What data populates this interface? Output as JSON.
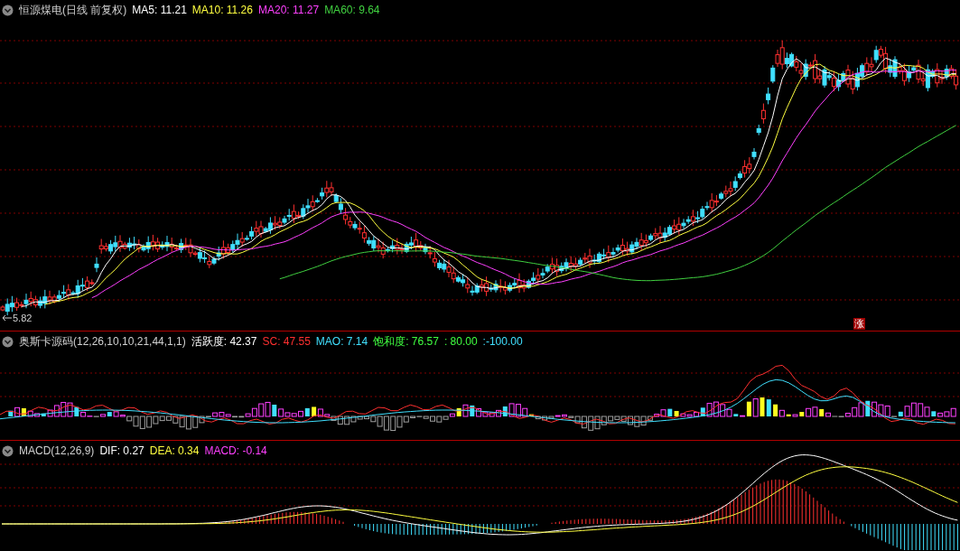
{
  "main_panel": {
    "title": "恒源煤电(日线 前复权)",
    "indicators": [
      {
        "label": "MA5: 11.21",
        "color": "#ffffff"
      },
      {
        "label": "MA10: 11.26",
        "color": "#ffff40"
      },
      {
        "label": "MA20: 11.27",
        "color": "#ff40ff"
      },
      {
        "label": "MA60: 9.64",
        "color": "#40d040"
      }
    ],
    "low_marker": "5.82",
    "signal_badge": "涨"
  },
  "oscillator_panel": {
    "title": "奥斯卡源码(12,26,10,10,21,44,1,1)",
    "readings": [
      {
        "label": "活跃度: 42.37",
        "color": "#ffffff"
      },
      {
        "label": "SC: 47.55",
        "color": "#ff3030"
      },
      {
        "label": "MAO: 7.14",
        "color": "#40e0ff"
      },
      {
        "label": "饱和度: 76.57",
        "color": "#40ff40"
      },
      {
        "label": ": 80.00",
        "color": "#40ff40"
      },
      {
        "label": ":-100.00",
        "color": "#40e0ff"
      }
    ]
  },
  "macd_panel": {
    "title": "MACD(12,26,9)",
    "readings": [
      {
        "label": "DIF: 0.27",
        "color": "#ffffff"
      },
      {
        "label": "DEA: 0.34",
        "color": "#ffff40"
      },
      {
        "label": "MACD: -0.14",
        "color": "#ff40ff"
      }
    ]
  }
}
